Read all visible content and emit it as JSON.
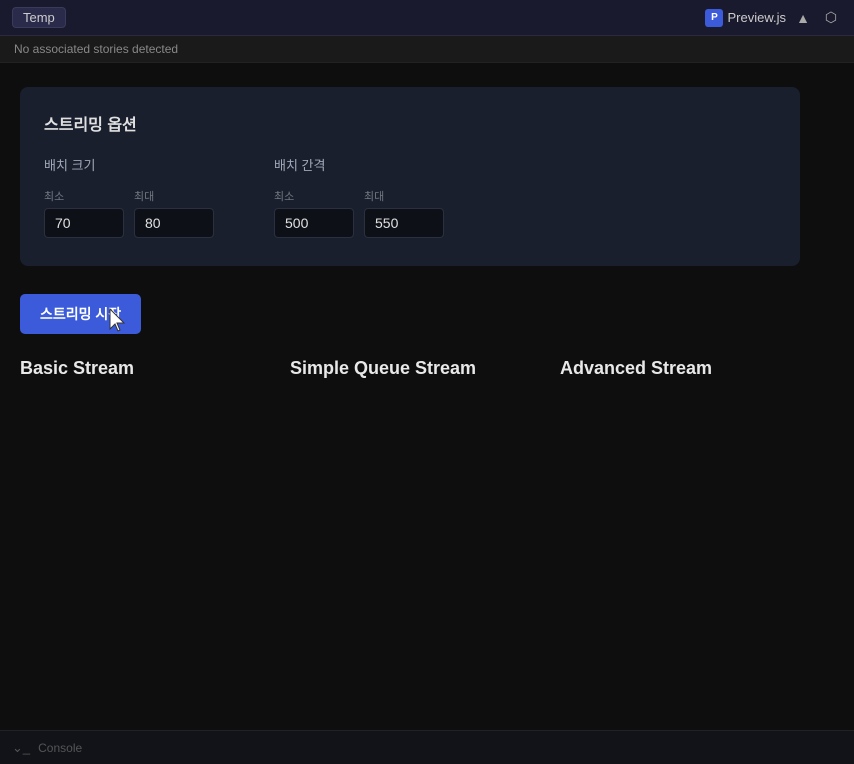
{
  "topbar": {
    "temp_label": "Temp",
    "preview_label": "Preview.js",
    "preview_logo_letter": "P",
    "expand_icon": "▲",
    "external_icon": "⬡"
  },
  "notice": {
    "text": "No associated stories detected"
  },
  "card": {
    "title": "스트리밍 옵션",
    "batch_size_label": "배치 크기",
    "batch_interval_label": "배치 간격",
    "min_label": "최소",
    "max_label": "최대",
    "batch_size_min": "70",
    "batch_size_max": "80",
    "batch_interval_min": "500",
    "batch_interval_max": "550"
  },
  "start_button": {
    "label": "스트리밍 시작"
  },
  "stream_types": {
    "basic": "Basic Stream",
    "simple_queue": "Simple Queue Stream",
    "advanced": "Advanced Stream"
  },
  "console": {
    "label": "Console"
  }
}
